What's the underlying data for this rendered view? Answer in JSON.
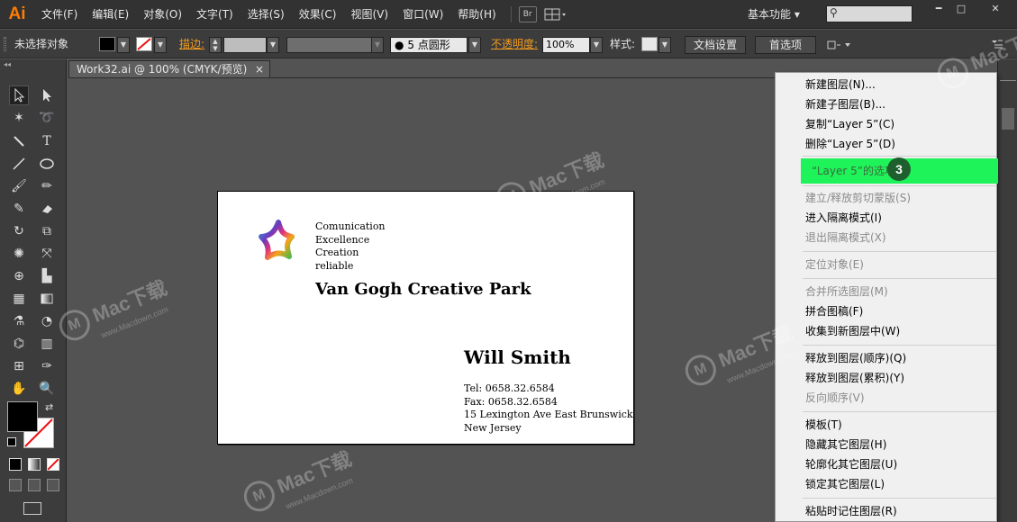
{
  "app": {
    "logo": "Ai"
  },
  "menubar": {
    "items": [
      "文件(F)",
      "编辑(E)",
      "对象(O)",
      "文字(T)",
      "选择(S)",
      "效果(C)",
      "视图(V)",
      "窗口(W)",
      "帮助(H)"
    ],
    "bridge_label": "Br",
    "workspace": "基本功能",
    "workspace_arrow": "▾",
    "search_glyph": "⚲",
    "window_controls": {
      "minimize": "━",
      "maximize": "□",
      "close": "✕"
    }
  },
  "controlbar": {
    "selection_status": "未选择对象",
    "stroke_label": "描边:",
    "brush_value": "5 点圆形",
    "opacity_label": "不透明度:",
    "opacity_value": "100%",
    "style_label": "样式:",
    "doc_setup_button": "文档设置",
    "preferences_button": "首选项"
  },
  "document": {
    "tab_title": "Work32.ai @ 100% (CMYK/预览)",
    "tab_close": "×"
  },
  "business_card": {
    "tagline": [
      "Comunication",
      "Excellence",
      "Creation",
      "reliable"
    ],
    "company": "Van Gogh Creative Park",
    "person": "Will Smith",
    "contact": [
      "Tel: 0658.32.6584",
      "Fax: 0658.32.6584",
      "15 Lexington Ave East Brunswick",
      "New Jersey"
    ]
  },
  "context_menu": {
    "items": [
      {
        "label": "新建图层(N)...",
        "disabled": false
      },
      {
        "label": "新建子图层(B)...",
        "disabled": false
      },
      {
        "label": "复制“Layer 5”(C)",
        "disabled": false
      },
      {
        "label": "删除“Layer 5”(D)",
        "disabled": false
      },
      {
        "label": "“Layer 5”的选项...",
        "disabled": false,
        "highlighted": true
      },
      {
        "label": "建立/释放剪切蒙版(S)",
        "disabled": true
      },
      {
        "label": "进入隔离模式(I)",
        "disabled": false
      },
      {
        "label": "退出隔离模式(X)",
        "disabled": true
      },
      {
        "label": "定位对象(E)",
        "disabled": true
      },
      {
        "label": "合并所选图层(M)",
        "disabled": true
      },
      {
        "label": "拼合图稿(F)",
        "disabled": false
      },
      {
        "label": "收集到新图层中(W)",
        "disabled": false
      },
      {
        "label": "释放到图层(顺序)(Q)",
        "disabled": false
      },
      {
        "label": "释放到图层(累积)(Y)",
        "disabled": false
      },
      {
        "label": "反向顺序(V)",
        "disabled": true
      },
      {
        "label": "模板(T)",
        "disabled": false
      },
      {
        "label": "隐藏其它图层(H)",
        "disabled": false
      },
      {
        "label": "轮廓化其它图层(U)",
        "disabled": false
      },
      {
        "label": "锁定其它图层(L)",
        "disabled": false
      },
      {
        "label": "粘贴时记住图层(R)",
        "disabled": false
      }
    ],
    "step_badge": "3"
  },
  "watermark": {
    "brand": "Mac下载",
    "url": "www.Macdown.com"
  },
  "colors": {
    "accent_orange": "#ff7c00",
    "highlight_green": "#1ff35a",
    "badge_green": "#1e5f2e"
  }
}
